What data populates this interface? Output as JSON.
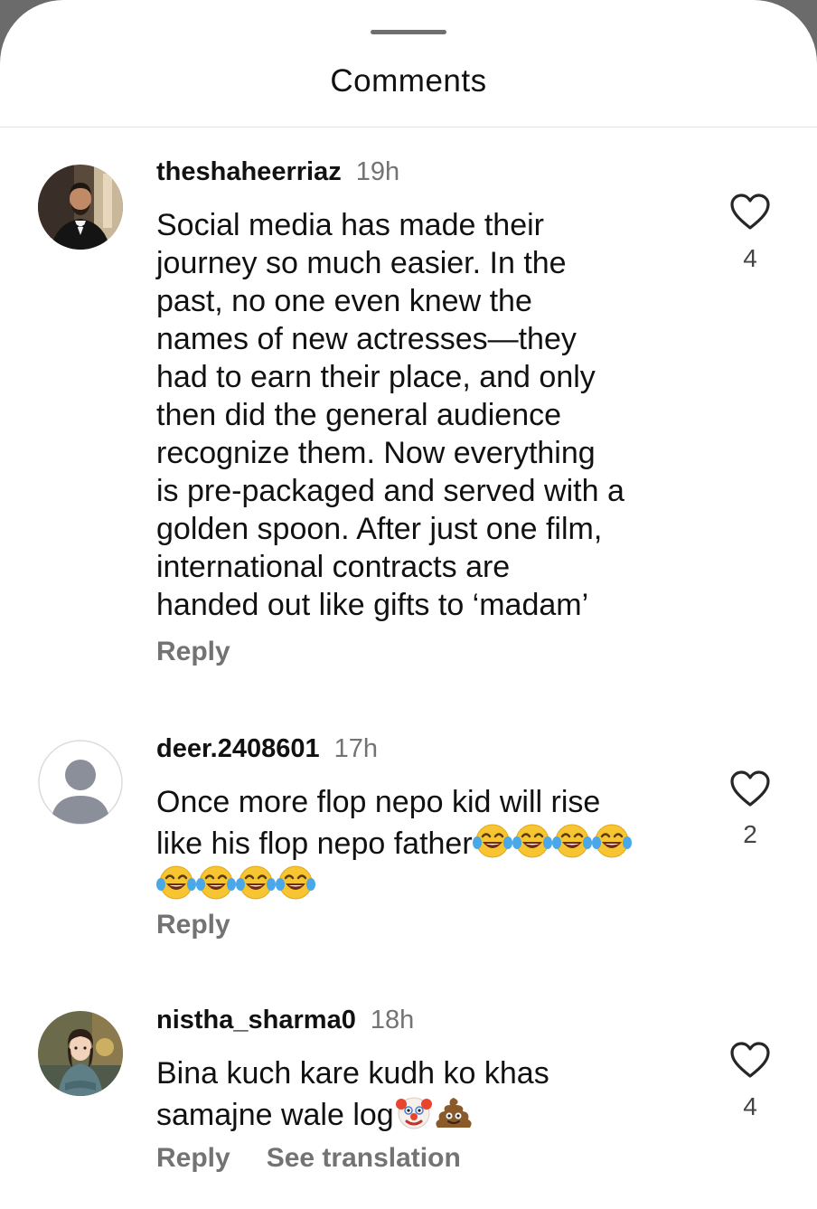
{
  "sheet": {
    "title": "Comments"
  },
  "comments": [
    {
      "username": "theshaheerriaz",
      "time": "19h",
      "text": "Social media has made their\njourney so much easier. In the\npast, no one even knew the\nnames of new actresses—they\nhad to earn their place, and only\nthen did the general audience\nrecognize them. Now everything\nis pre-packaged and served with a\ngolden spoon. After just one film,\ninternational contracts are\nhanded out like gifts to ‘madam’",
      "reply_label": "Reply",
      "likes": "4",
      "avatar": "photo-man-in-tuxedo"
    },
    {
      "username": "deer.2408601",
      "time": "17h",
      "text_line1": "Once more flop nepo kid will rise",
      "text_line2": "like his flop nepo father",
      "emoji": "face-with-tears-of-joy",
      "emoji_count": 8,
      "reply_label": "Reply",
      "likes": "2",
      "avatar": "default-avatar"
    },
    {
      "username": "nistha_sharma0",
      "time": "18h",
      "text_line1": "Bina kuch kare kudh ko khas",
      "text_line2": "samajne wale log",
      "emojis": [
        "clown-face",
        "pile-of-poo"
      ],
      "reply_label": "Reply",
      "see_translation_label": "See translation",
      "likes": "4",
      "avatar": "illustrated-woman"
    }
  ],
  "colors": {
    "background": "#ffffff",
    "text_primary": "#111111",
    "text_secondary": "#737373",
    "divider": "#e2e2e2"
  }
}
